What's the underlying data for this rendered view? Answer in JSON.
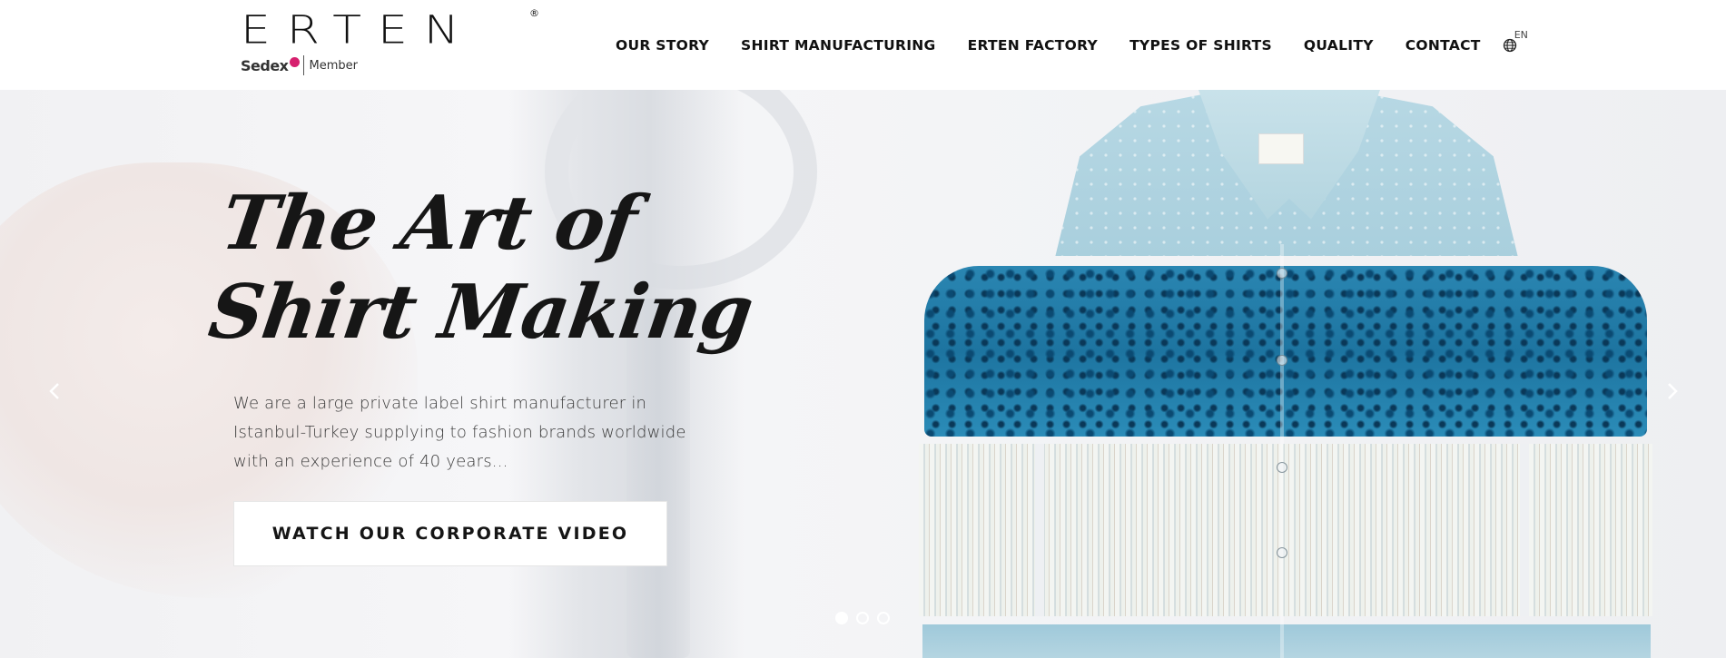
{
  "brand": {
    "logo_text": "ERTEN",
    "registered_mark": "®",
    "sedex_text": "Sedex",
    "member_text": "Member"
  },
  "nav": {
    "items": [
      {
        "label": "OUR STORY"
      },
      {
        "label": "SHIRT MANUFACTURING"
      },
      {
        "label": "ERTEN FACTORY"
      },
      {
        "label": "TYPES OF SHIRTS"
      },
      {
        "label": "QUALITY"
      },
      {
        "label": "CONTACT"
      }
    ],
    "language": {
      "label": "EN",
      "icon": "globe-icon"
    }
  },
  "hero": {
    "headline_line1": "The Art of",
    "headline_line2": "Shirt Making",
    "subtitle": "We are a large private label shirt manufacturer in Istanbul-Turkey supplying to fashion brands worldwide with an experience of 40 years...",
    "cta_label": "WATCH OUR CORPORATE VIDEO",
    "prev_icon": "chevron-left-icon",
    "next_icon": "chevron-right-icon",
    "slides": {
      "count": 3,
      "active": 1
    }
  },
  "colors": {
    "accent_pink": "#d6206e",
    "text_dark": "#111111",
    "shirt_light_blue": "#b7d8e4",
    "shirt_paisley_blue": "#1d74a0"
  }
}
